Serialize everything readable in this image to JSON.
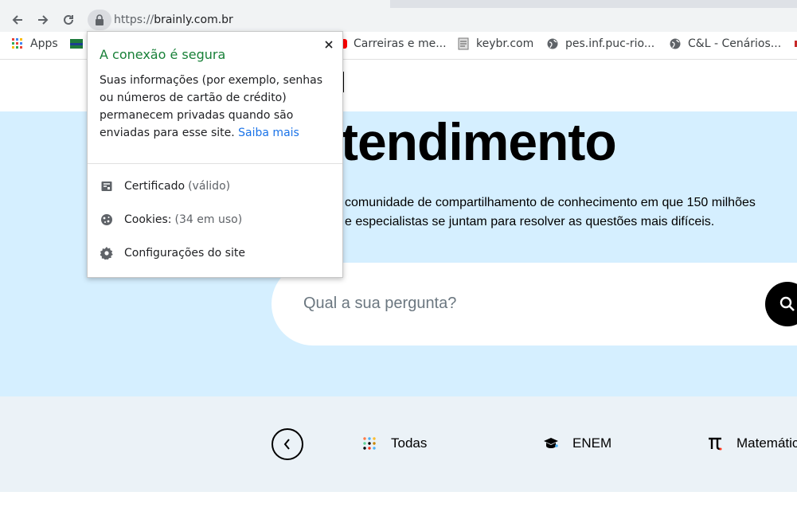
{
  "browser": {
    "url_scheme": "https://",
    "url_host": "brainly.com.br",
    "icons": {
      "back": "back-arrow-icon",
      "forward": "forward-arrow-icon",
      "reload": "reload-icon",
      "lock": "lock-icon"
    }
  },
  "bookmarks": [
    {
      "label": "Apps",
      "icon": "apps-grid-icon"
    },
    {
      "label": "Carreiras e me...",
      "icon": "youtube-icon"
    },
    {
      "label": "keybr.com",
      "icon": "page-icon"
    },
    {
      "label": "pes.inf.puc-rio...",
      "icon": "globe-icon"
    },
    {
      "label": "C&L - Cenários...",
      "icon": "globe-icon"
    }
  ],
  "security_popup": {
    "title": "A conexão é segura",
    "body_text": "Suas informações (por exemplo, senhas ou números de cartão de crédito) permanecem privadas quando são enviadas para esse site.",
    "learn_more": "Saiba mais",
    "certificate_label": "Certificado",
    "certificate_status": "(válido)",
    "cookies_label": "Cookies:",
    "cookies_status": "(34 em uso)",
    "site_settings_label": "Configurações do site"
  },
  "hero": {
    "title": "tendimento",
    "desc_line1": "comunidade de compartilhamento de conhecimento em que 150 milhões",
    "desc_line2": "e especialistas se juntam para resolver as questões mais difíceis."
  },
  "search": {
    "placeholder": "Qual a sua pergunta?"
  },
  "categories": [
    {
      "label": "Todas",
      "icon": "all-dots-icon"
    },
    {
      "label": "ENEM",
      "icon": "graduation-cap-icon"
    },
    {
      "label": "Matemática",
      "icon": "pi-icon"
    }
  ],
  "colors": {
    "hero_bg": "#d5efff",
    "categories_bg": "#ebf2f7",
    "secure_green": "#188038",
    "link_blue": "#1a73e8"
  }
}
